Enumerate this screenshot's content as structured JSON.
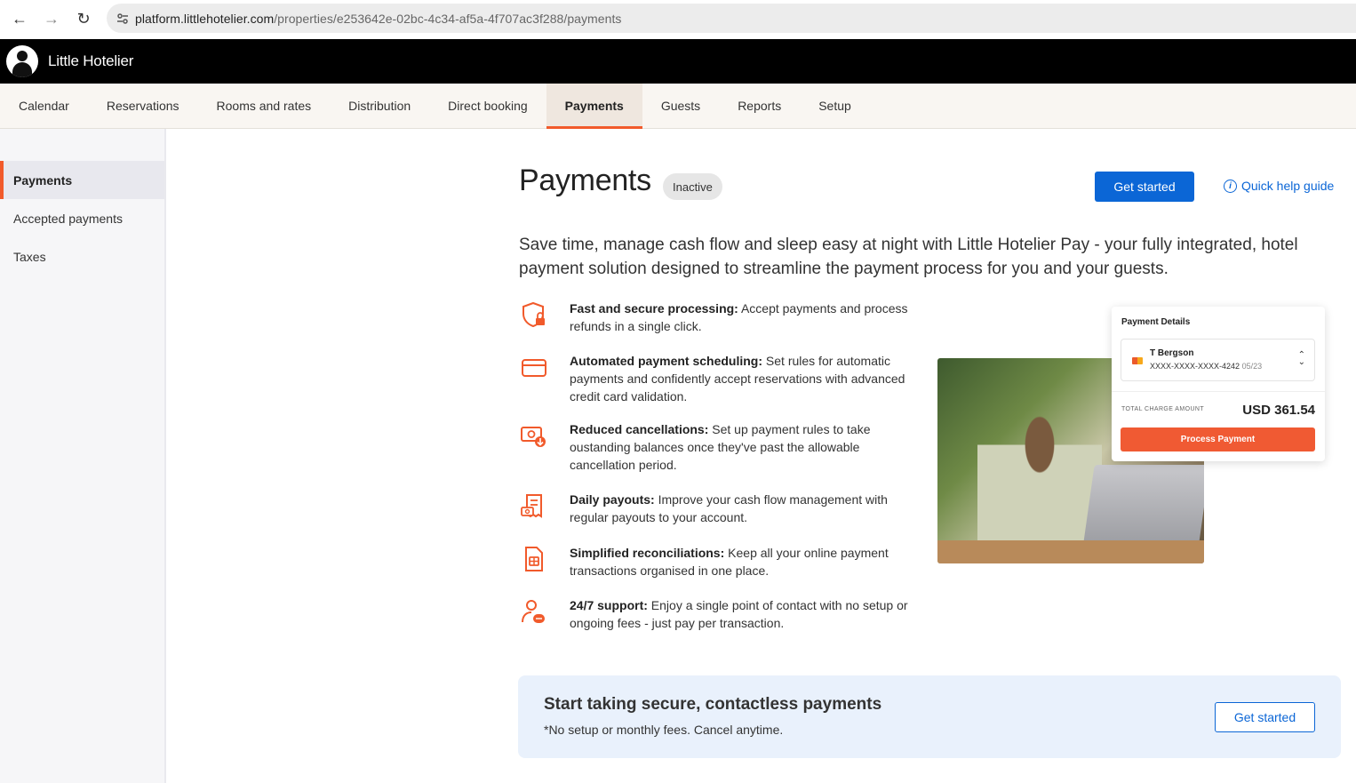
{
  "browser": {
    "url_domain": "platform.littlehotelier.com",
    "url_path": "/properties/e253642e-02bc-4c34-af5a-4f707ac3f288/payments"
  },
  "app": {
    "name": "Little Hotelier"
  },
  "tabs": [
    {
      "label": "Calendar"
    },
    {
      "label": "Reservations"
    },
    {
      "label": "Rooms and rates"
    },
    {
      "label": "Distribution"
    },
    {
      "label": "Direct booking"
    },
    {
      "label": "Payments",
      "active": true
    },
    {
      "label": "Guests"
    },
    {
      "label": "Reports"
    },
    {
      "label": "Setup"
    }
  ],
  "sidebar": {
    "items": [
      {
        "label": "Payments",
        "active": true
      },
      {
        "label": "Accepted payments"
      },
      {
        "label": "Taxes"
      }
    ]
  },
  "main": {
    "title": "Payments",
    "status_badge": "Inactive",
    "get_started_label": "Get started",
    "help_link": "Quick help guide",
    "intro": "Save time, manage cash flow and sleep easy at night with Little Hotelier Pay - your fully integrated, hotel payment solution designed to streamline the payment process for you and your guests.",
    "features": [
      {
        "title": "Fast and secure processing:",
        "text": " Accept payments and process refunds in a single click.",
        "icon": "shield-lock-icon"
      },
      {
        "title": "Automated payment scheduling:",
        "text": " Set rules for automatic payments and confidently accept reservations with advanced credit card validation.",
        "icon": "credit-card-icon"
      },
      {
        "title": "Reduced cancellations:",
        "text": " Set up payment rules to take oustanding balances once they've past the allowable cancellation period.",
        "icon": "cash-download-icon"
      },
      {
        "title": "Daily payouts:",
        "text": " Improve your cash flow management with regular payouts to your account.",
        "icon": "receipt-icon"
      },
      {
        "title": "Simplified reconciliations:",
        "text": " Keep all your online payment transactions organised in one place.",
        "icon": "document-icon"
      },
      {
        "title": "24/7 support:",
        "text": " Enjoy a single point of contact with no setup or ongoing fees - just pay per transaction.",
        "icon": "support-chat-icon"
      }
    ]
  },
  "payment_card": {
    "title": "Payment Details",
    "card_name": "T Bergson",
    "card_number": "XXXX-XXXX-XXXX-4242",
    "card_expiry": "05/23",
    "total_label": "TOTAL CHARGE AMOUNT",
    "total_value": "USD 361.54",
    "button_label": "Process Payment"
  },
  "cta": {
    "title": "Start taking secure, contactless payments",
    "subtitle": "*No setup or monthly fees. Cancel anytime.",
    "button_label": "Get started"
  },
  "colors": {
    "accent": "#f15a2b",
    "primary": "#0b66d6",
    "header_bg": "#000000",
    "cta_bg": "#e9f1fc"
  }
}
